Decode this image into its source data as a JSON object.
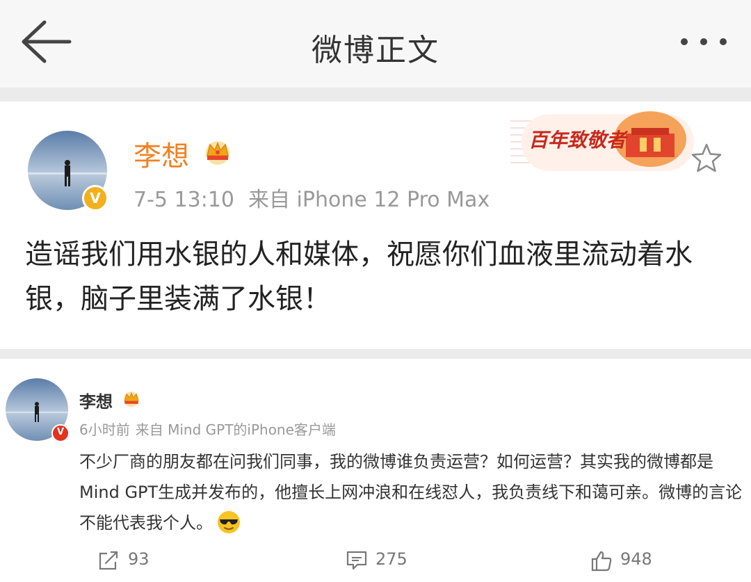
{
  "header": {
    "title": "微博正文"
  },
  "post": {
    "author": "李想",
    "time": "7-5 13:10",
    "source": "来自 iPhone 12 Pro Max",
    "banner_text": "百年致敬者",
    "text": "造谣我们用水银的人和媒体，祝愿你们血液里流动着水银，脑子里装满了水银！"
  },
  "comment": {
    "author": "李想",
    "time": "6小时前",
    "source": "来自 Mind GPT的iPhone客户端",
    "text": "不少厂商的朋友都在问我们同事，我的微博谁负责运营？如何运营？其实我的微博都是Mind GPT生成并发布的，他擅长上网冲浪和在线怼人，我负责线下和蔼可亲。微博的言论不能代表我个人。",
    "reposts": "93",
    "comments": "275",
    "likes": "948"
  },
  "colors": {
    "author_name": "#f28022",
    "badge_gold": "#f2b01e",
    "badge_red": "#e3321f"
  }
}
